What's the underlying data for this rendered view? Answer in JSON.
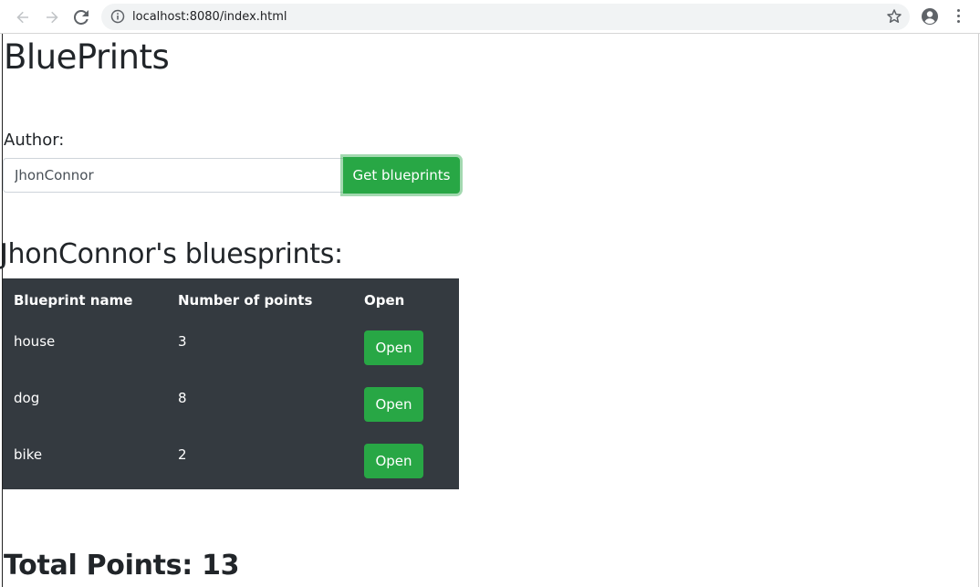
{
  "browser": {
    "url": "localhost:8080/index.html"
  },
  "page": {
    "title": "BluePrints",
    "author_label": "Author:",
    "author_input_value": "JhonConnor",
    "get_button_label": "Get blueprints",
    "section_heading": "JhonConnor's bluesprints:",
    "total_points_text": "Total Points: 13"
  },
  "table": {
    "headers": [
      "Blueprint name",
      "Number of points",
      "Open"
    ],
    "rows": [
      {
        "name": "house",
        "points": "3",
        "action": "Open"
      },
      {
        "name": "dog",
        "points": "8",
        "action": "Open"
      },
      {
        "name": "bike",
        "points": "2",
        "action": "Open"
      }
    ]
  },
  "colors": {
    "table_bg": "#343a40",
    "success": "#28a745"
  },
  "icons": [
    "back-arrow-icon",
    "forward-arrow-icon",
    "reload-icon",
    "info-icon",
    "star-icon",
    "profile-icon",
    "menu-dots-icon"
  ]
}
